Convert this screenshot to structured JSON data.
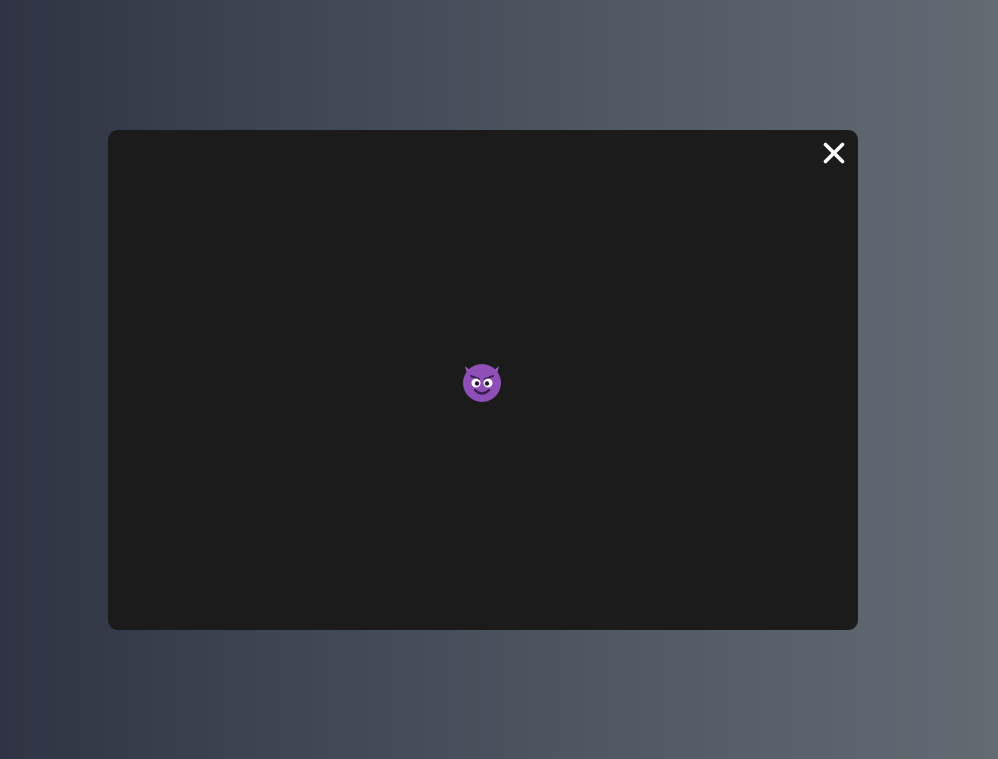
{
  "modal": {
    "close_icon": "close-icon",
    "center_icon": "smiling-imp-icon",
    "colors": {
      "background": "#1b1b1b",
      "close": "#ffffff",
      "imp_face": "#8e4fb6",
      "imp_horn": "#9b5ec4"
    }
  }
}
